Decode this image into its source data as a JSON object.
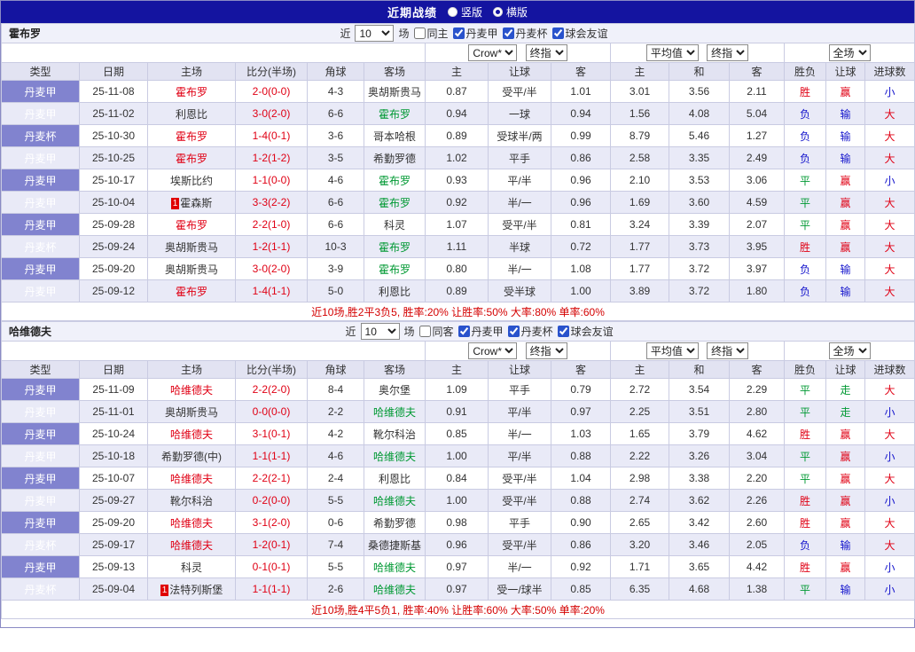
{
  "titlebar": {
    "title": "近期战绩",
    "radios": [
      {
        "label": "竖版",
        "checked": false
      },
      {
        "label": "横版",
        "checked": true
      }
    ]
  },
  "labels": {
    "recent_prefix": "近",
    "recent_suffix": "场"
  },
  "columns": {
    "type": "类型",
    "date": "日期",
    "home": "主场",
    "score": "比分(半场)",
    "corner": "角球",
    "away": "客场",
    "odds_home": "主",
    "odds_handicap": "让球",
    "odds_away": "客",
    "avg_home": "主",
    "avg_draw": "和",
    "avg_away": "客",
    "result": "胜负",
    "handicap_result": "让球",
    "goals": "进球数"
  },
  "colors": {
    "accent_navy": "#1414a0",
    "type_purple": "#8183cf",
    "win_red": "#e00014",
    "lose_blue": "#1414cc",
    "draw_green": "#009933"
  },
  "sections": [
    {
      "team": "霍布罗",
      "count_select": "10",
      "filters": [
        {
          "label": "同主",
          "checked": false
        },
        {
          "label": "丹麦甲",
          "checked": true
        },
        {
          "label": "丹麦杯",
          "checked": true
        },
        {
          "label": "球会友谊",
          "checked": true
        }
      ],
      "selects": {
        "company": "Crow*",
        "company_mode": "终指",
        "average": "平均值",
        "average_mode": "终指",
        "scope": "全场"
      },
      "rows": [
        {
          "type": "丹麦甲",
          "date": "25-11-08",
          "home": "霍布罗",
          "home_color": "red",
          "home_badge": "",
          "score": "2-0(0-0)",
          "corner": "4-3",
          "away": "奥胡斯贵马",
          "away_color": "",
          "odds": [
            "0.87",
            "受平/半",
            "1.01"
          ],
          "avg": [
            "3.01",
            "3.56",
            "2.11"
          ],
          "result": {
            "text": "胜",
            "color": "red"
          },
          "handicap": {
            "text": "赢",
            "color": "red"
          },
          "goals": {
            "text": "小",
            "color": "blue"
          }
        },
        {
          "type": "丹麦甲",
          "date": "25-11-02",
          "home": "利恩比",
          "home_color": "",
          "home_badge": "",
          "score": "3-0(2-0)",
          "corner": "6-6",
          "away": "霍布罗",
          "away_color": "green",
          "odds": [
            "0.94",
            "一球",
            "0.94"
          ],
          "avg": [
            "1.56",
            "4.08",
            "5.04"
          ],
          "result": {
            "text": "负",
            "color": "blue"
          },
          "handicap": {
            "text": "输",
            "color": "blue"
          },
          "goals": {
            "text": "大",
            "color": "red"
          }
        },
        {
          "type": "丹麦杯",
          "date": "25-10-30",
          "home": "霍布罗",
          "home_color": "red",
          "home_badge": "",
          "score": "1-4(0-1)",
          "corner": "3-6",
          "away": "哥本哈根",
          "away_color": "",
          "odds": [
            "0.89",
            "受球半/两",
            "0.99"
          ],
          "avg": [
            "8.79",
            "5.46",
            "1.27"
          ],
          "result": {
            "text": "负",
            "color": "blue"
          },
          "handicap": {
            "text": "输",
            "color": "blue"
          },
          "goals": {
            "text": "大",
            "color": "red"
          }
        },
        {
          "type": "丹麦甲",
          "date": "25-10-25",
          "home": "霍布罗",
          "home_color": "red",
          "home_badge": "",
          "score": "1-2(1-2)",
          "corner": "3-5",
          "away": "希勤罗德",
          "away_color": "",
          "odds": [
            "1.02",
            "平手",
            "0.86"
          ],
          "avg": [
            "2.58",
            "3.35",
            "2.49"
          ],
          "result": {
            "text": "负",
            "color": "blue"
          },
          "handicap": {
            "text": "输",
            "color": "blue"
          },
          "goals": {
            "text": "大",
            "color": "red"
          }
        },
        {
          "type": "丹麦甲",
          "date": "25-10-17",
          "home": "埃斯比约",
          "home_color": "",
          "home_badge": "",
          "score": "1-1(0-0)",
          "corner": "4-6",
          "away": "霍布罗",
          "away_color": "green",
          "odds": [
            "0.93",
            "平/半",
            "0.96"
          ],
          "avg": [
            "2.10",
            "3.53",
            "3.06"
          ],
          "result": {
            "text": "平",
            "color": "green"
          },
          "handicap": {
            "text": "赢",
            "color": "red"
          },
          "goals": {
            "text": "小",
            "color": "blue"
          }
        },
        {
          "type": "丹麦甲",
          "date": "25-10-04",
          "home": "霍森斯",
          "home_color": "",
          "home_badge": "1",
          "score": "3-3(2-2)",
          "corner": "6-6",
          "away": "霍布罗",
          "away_color": "green",
          "odds": [
            "0.92",
            "半/一",
            "0.96"
          ],
          "avg": [
            "1.69",
            "3.60",
            "4.59"
          ],
          "result": {
            "text": "平",
            "color": "green"
          },
          "handicap": {
            "text": "赢",
            "color": "red"
          },
          "goals": {
            "text": "大",
            "color": "red"
          }
        },
        {
          "type": "丹麦甲",
          "date": "25-09-28",
          "home": "霍布罗",
          "home_color": "red",
          "home_badge": "",
          "score": "2-2(1-0)",
          "corner": "6-6",
          "away": "科灵",
          "away_color": "",
          "odds": [
            "1.07",
            "受平/半",
            "0.81"
          ],
          "avg": [
            "3.24",
            "3.39",
            "2.07"
          ],
          "result": {
            "text": "平",
            "color": "green"
          },
          "handicap": {
            "text": "赢",
            "color": "red"
          },
          "goals": {
            "text": "大",
            "color": "red"
          }
        },
        {
          "type": "丹麦杯",
          "date": "25-09-24",
          "home": "奥胡斯贵马",
          "home_color": "",
          "home_badge": "",
          "score": "1-2(1-1)",
          "corner": "10-3",
          "away": "霍布罗",
          "away_color": "green",
          "odds": [
            "1.11",
            "半球",
            "0.72"
          ],
          "avg": [
            "1.77",
            "3.73",
            "3.95"
          ],
          "result": {
            "text": "胜",
            "color": "red"
          },
          "handicap": {
            "text": "赢",
            "color": "red"
          },
          "goals": {
            "text": "大",
            "color": "red"
          }
        },
        {
          "type": "丹麦甲",
          "date": "25-09-20",
          "home": "奥胡斯贵马",
          "home_color": "",
          "home_badge": "",
          "score": "3-0(2-0)",
          "corner": "3-9",
          "away": "霍布罗",
          "away_color": "green",
          "odds": [
            "0.80",
            "半/一",
            "1.08"
          ],
          "avg": [
            "1.77",
            "3.72",
            "3.97"
          ],
          "result": {
            "text": "负",
            "color": "blue"
          },
          "handicap": {
            "text": "输",
            "color": "blue"
          },
          "goals": {
            "text": "大",
            "color": "red"
          }
        },
        {
          "type": "丹麦甲",
          "date": "25-09-12",
          "home": "霍布罗",
          "home_color": "red",
          "home_badge": "",
          "score": "1-4(1-1)",
          "corner": "5-0",
          "away": "利恩比",
          "away_color": "",
          "odds": [
            "0.89",
            "受半球",
            "1.00"
          ],
          "avg": [
            "3.89",
            "3.72",
            "1.80"
          ],
          "result": {
            "text": "负",
            "color": "blue"
          },
          "handicap": {
            "text": "输",
            "color": "blue"
          },
          "goals": {
            "text": "大",
            "color": "red"
          }
        }
      ],
      "summary": "近10场,胜2平3负5, 胜率:20% 让胜率:50% 大率:80% 单率:60%"
    },
    {
      "team": "哈维德夫",
      "count_select": "10",
      "filters": [
        {
          "label": "同客",
          "checked": false
        },
        {
          "label": "丹麦甲",
          "checked": true
        },
        {
          "label": "丹麦杯",
          "checked": true
        },
        {
          "label": "球会友谊",
          "checked": true
        }
      ],
      "selects": {
        "company": "Crow*",
        "company_mode": "终指",
        "average": "平均值",
        "average_mode": "终指",
        "scope": "全场"
      },
      "rows": [
        {
          "type": "丹麦甲",
          "date": "25-11-09",
          "home": "哈维德夫",
          "home_color": "red",
          "home_badge": "",
          "score": "2-2(2-0)",
          "corner": "8-4",
          "away": "奥尔堡",
          "away_color": "",
          "odds": [
            "1.09",
            "平手",
            "0.79"
          ],
          "avg": [
            "2.72",
            "3.54",
            "2.29"
          ],
          "result": {
            "text": "平",
            "color": "green"
          },
          "handicap": {
            "text": "走",
            "color": "green"
          },
          "goals": {
            "text": "大",
            "color": "red"
          }
        },
        {
          "type": "丹麦甲",
          "date": "25-11-01",
          "home": "奥胡斯贵马",
          "home_color": "",
          "home_badge": "",
          "score": "0-0(0-0)",
          "corner": "2-2",
          "away": "哈维德夫",
          "away_color": "green",
          "odds": [
            "0.91",
            "平/半",
            "0.97"
          ],
          "avg": [
            "2.25",
            "3.51",
            "2.80"
          ],
          "result": {
            "text": "平",
            "color": "green"
          },
          "handicap": {
            "text": "走",
            "color": "green"
          },
          "goals": {
            "text": "小",
            "color": "blue"
          }
        },
        {
          "type": "丹麦甲",
          "date": "25-10-24",
          "home": "哈维德夫",
          "home_color": "red",
          "home_badge": "",
          "score": "3-1(0-1)",
          "corner": "4-2",
          "away": "靴尔科治",
          "away_color": "",
          "odds": [
            "0.85",
            "半/一",
            "1.03"
          ],
          "avg": [
            "1.65",
            "3.79",
            "4.62"
          ],
          "result": {
            "text": "胜",
            "color": "red"
          },
          "handicap": {
            "text": "赢",
            "color": "red"
          },
          "goals": {
            "text": "大",
            "color": "red"
          }
        },
        {
          "type": "丹麦甲",
          "date": "25-10-18",
          "home": "希勤罗德(中)",
          "home_color": "",
          "home_badge": "",
          "score": "1-1(1-1)",
          "corner": "4-6",
          "away": "哈维德夫",
          "away_color": "green",
          "odds": [
            "1.00",
            "平/半",
            "0.88"
          ],
          "avg": [
            "2.22",
            "3.26",
            "3.04"
          ],
          "result": {
            "text": "平",
            "color": "green"
          },
          "handicap": {
            "text": "赢",
            "color": "red"
          },
          "goals": {
            "text": "小",
            "color": "blue"
          }
        },
        {
          "type": "丹麦甲",
          "date": "25-10-07",
          "home": "哈维德夫",
          "home_color": "red",
          "home_badge": "",
          "score": "2-2(2-1)",
          "corner": "2-4",
          "away": "利恩比",
          "away_color": "",
          "odds": [
            "0.84",
            "受平/半",
            "1.04"
          ],
          "avg": [
            "2.98",
            "3.38",
            "2.20"
          ],
          "result": {
            "text": "平",
            "color": "green"
          },
          "handicap": {
            "text": "赢",
            "color": "red"
          },
          "goals": {
            "text": "大",
            "color": "red"
          }
        },
        {
          "type": "丹麦甲",
          "date": "25-09-27",
          "home": "靴尔科治",
          "home_color": "",
          "home_badge": "",
          "score": "0-2(0-0)",
          "corner": "5-5",
          "away": "哈维德夫",
          "away_color": "green",
          "odds": [
            "1.00",
            "受平/半",
            "0.88"
          ],
          "avg": [
            "2.74",
            "3.62",
            "2.26"
          ],
          "result": {
            "text": "胜",
            "color": "red"
          },
          "handicap": {
            "text": "赢",
            "color": "red"
          },
          "goals": {
            "text": "小",
            "color": "blue"
          }
        },
        {
          "type": "丹麦甲",
          "date": "25-09-20",
          "home": "哈维德夫",
          "home_color": "red",
          "home_badge": "",
          "score": "3-1(2-0)",
          "corner": "0-6",
          "away": "希勤罗德",
          "away_color": "",
          "odds": [
            "0.98",
            "平手",
            "0.90"
          ],
          "avg": [
            "2.65",
            "3.42",
            "2.60"
          ],
          "result": {
            "text": "胜",
            "color": "red"
          },
          "handicap": {
            "text": "赢",
            "color": "red"
          },
          "goals": {
            "text": "大",
            "color": "red"
          }
        },
        {
          "type": "丹麦杯",
          "date": "25-09-17",
          "home": "哈维德夫",
          "home_color": "red",
          "home_badge": "",
          "score": "1-2(0-1)",
          "corner": "7-4",
          "away": "桑德捷斯基",
          "away_color": "",
          "odds": [
            "0.96",
            "受平/半",
            "0.86"
          ],
          "avg": [
            "3.20",
            "3.46",
            "2.05"
          ],
          "result": {
            "text": "负",
            "color": "blue"
          },
          "handicap": {
            "text": "输",
            "color": "blue"
          },
          "goals": {
            "text": "大",
            "color": "red"
          }
        },
        {
          "type": "丹麦甲",
          "date": "25-09-13",
          "home": "科灵",
          "home_color": "",
          "home_badge": "",
          "score": "0-1(0-1)",
          "corner": "5-5",
          "away": "哈维德夫",
          "away_color": "green",
          "odds": [
            "0.97",
            "半/一",
            "0.92"
          ],
          "avg": [
            "1.71",
            "3.65",
            "4.42"
          ],
          "result": {
            "text": "胜",
            "color": "red"
          },
          "handicap": {
            "text": "赢",
            "color": "red"
          },
          "goals": {
            "text": "小",
            "color": "blue"
          }
        },
        {
          "type": "丹麦杯",
          "date": "25-09-04",
          "home": "法特列斯堡",
          "home_color": "",
          "home_badge": "1",
          "score": "1-1(1-1)",
          "corner": "2-6",
          "away": "哈维德夫",
          "away_color": "green",
          "odds": [
            "0.97",
            "受一/球半",
            "0.85"
          ],
          "avg": [
            "6.35",
            "4.68",
            "1.38"
          ],
          "result": {
            "text": "平",
            "color": "green"
          },
          "handicap": {
            "text": "输",
            "color": "blue"
          },
          "goals": {
            "text": "小",
            "color": "blue"
          }
        }
      ],
      "summary": "近10场,胜4平5负1, 胜率:40% 让胜率:60% 大率:50% 单率:20%"
    }
  ]
}
